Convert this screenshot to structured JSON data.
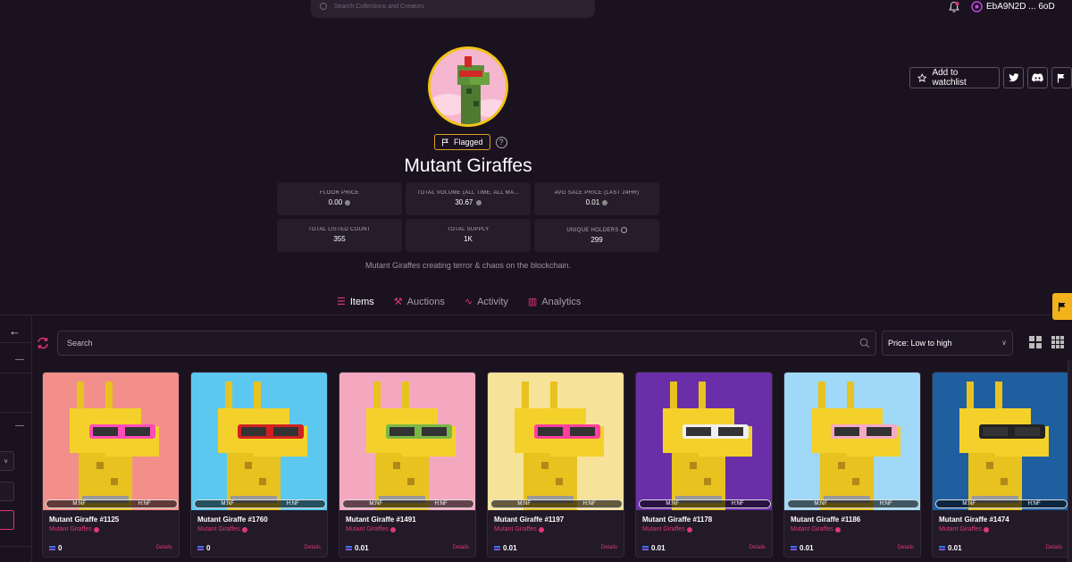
{
  "header": {
    "search_placeholder": "Search Collections and Creators",
    "account_label": "EbA9N2D ... 6oD"
  },
  "collection": {
    "flag_label": "Flagged",
    "help_mark": "?",
    "title": "Mutant Giraffes",
    "watchlist_label": "Add to watchlist",
    "description": "Mutant Giraffes creating terror & chaos on the blockchain."
  },
  "stats": [
    {
      "label": "FLOOR PRICE",
      "value": "0.00"
    },
    {
      "label": "TOTAL VOLUME (ALL TIME, ALL MA...",
      "value": "30.67"
    },
    {
      "label": "AVG SALE PRICE (LAST 24HR)",
      "value": "0.01"
    },
    {
      "label": "TOTAL LISTED COUNT",
      "value": "355"
    },
    {
      "label": "TOTAL SUPPLY",
      "value": "1K"
    },
    {
      "label": "UNIQUE HOLDERS",
      "value": "299"
    }
  ],
  "tabs": [
    {
      "label": "Items",
      "icon": "list-icon"
    },
    {
      "label": "Auctions",
      "icon": "gavel-icon"
    },
    {
      "label": "Activity",
      "icon": "pulse-icon"
    },
    {
      "label": "Analytics",
      "icon": "bar-chart-icon"
    }
  ],
  "toolbar": {
    "search_placeholder": "Search",
    "sort_value": "Price: Low to high"
  },
  "cards": [
    {
      "name": "Mutant Giraffe #1125",
      "collection": "Mutant Giraffes",
      "price": "0",
      "details": "Details",
      "tag_left": "M:NF",
      "tag_right": "H:NF",
      "bg": "#f28f8a"
    },
    {
      "name": "Mutant Giraffe #1760",
      "collection": "Mutant Giraffes",
      "price": "0",
      "details": "Details",
      "tag_left": "M:NF",
      "tag_right": "H:NF",
      "bg": "#5cc8f0"
    },
    {
      "name": "Mutant Giraffe #1491",
      "collection": "Mutant Giraffes",
      "price": "0.01",
      "details": "Details",
      "tag_left": "M:NF",
      "tag_right": "H:NF",
      "bg": "#f4a8c0"
    },
    {
      "name": "Mutant Giraffe #1197",
      "collection": "Mutant Giraffes",
      "price": "0.01",
      "details": "Details",
      "tag_left": "M:NF",
      "tag_right": "H:NF",
      "bg": "#f7e29a"
    },
    {
      "name": "Mutant Giraffe #1178",
      "collection": "Mutant Giraffes",
      "price": "0.01",
      "details": "Details",
      "tag_left": "M:NF",
      "tag_right": "H:NF",
      "bg": "#6a2fa8"
    },
    {
      "name": "Mutant Giraffe #1186",
      "collection": "Mutant Giraffes",
      "price": "0.01",
      "details": "Details",
      "tag_left": "M:NF",
      "tag_right": "H:NF",
      "bg": "#9fd9f7"
    },
    {
      "name": "Mutant Giraffe #1474",
      "collection": "Mutant Giraffes",
      "price": "0.01",
      "details": "Details",
      "tag_left": "M:NF",
      "tag_right": "H:NF",
      "bg": "#1f5fa0"
    }
  ],
  "colors": {
    "accent": "#e0357a",
    "flag": "#f2b21b",
    "background": "#1a121f"
  }
}
